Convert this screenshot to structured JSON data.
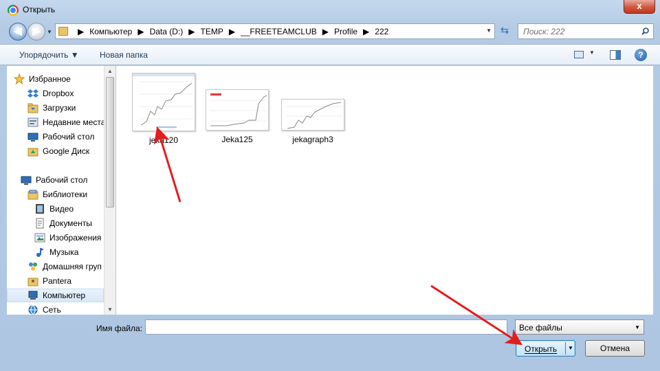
{
  "window": {
    "title": "Открыть",
    "close_glyph": "x"
  },
  "nav_buttons": {
    "back_glyph": "◀",
    "forward_glyph": "▶",
    "dropdown_glyph": "▼"
  },
  "address": {
    "crumbs": [
      "Компьютер",
      "Data (D:)",
      "TEMP",
      "__FREETEAMCLUB",
      "Profile",
      "222"
    ],
    "separator": "▶",
    "dropdown_glyph": "▼",
    "refresh_glyph": "⇆"
  },
  "search": {
    "placeholder": "Поиск: 222"
  },
  "toolbar": {
    "organize_label": "Упорядочить ▼",
    "new_folder_label": "Новая папка",
    "views_dropdown": "▼",
    "help_glyph": "?"
  },
  "navpane": {
    "items": [
      {
        "label": "Избранное",
        "icon": "star-icon",
        "indent": 0
      },
      {
        "label": "Dropbox",
        "icon": "dropbox-icon",
        "indent": 1
      },
      {
        "label": "Загрузки",
        "icon": "downloads-folder-icon",
        "indent": 1
      },
      {
        "label": "Недавние места",
        "icon": "recent-places-icon",
        "indent": 1
      },
      {
        "label": "Рабочий стол",
        "icon": "desktop-icon",
        "indent": 1
      },
      {
        "label": "Google Диск",
        "icon": "google-drive-folder-icon",
        "indent": 1
      },
      {
        "label": "Рабочий стол",
        "icon": "desktop-icon",
        "indent": 0
      },
      {
        "label": "Библиотеки",
        "icon": "libraries-icon",
        "indent": 1
      },
      {
        "label": "Видео",
        "icon": "video-icon",
        "indent": 2
      },
      {
        "label": "Документы",
        "icon": "documents-icon",
        "indent": 2
      },
      {
        "label": "Изображения",
        "icon": "pictures-icon",
        "indent": 2
      },
      {
        "label": "Музыка",
        "icon": "music-icon",
        "indent": 2
      },
      {
        "label": "Домашняя груп",
        "icon": "homegroup-icon",
        "indent": 1
      },
      {
        "label": "Pantera",
        "icon": "user-folder-icon",
        "indent": 1
      },
      {
        "label": "Компьютер",
        "icon": "computer-icon",
        "indent": 1,
        "selected": true
      },
      {
        "label": "Сеть",
        "icon": "network-icon",
        "indent": 1
      }
    ],
    "scroll_up": "▲",
    "scroll_down": "▼"
  },
  "files": [
    {
      "name": "jeka120"
    },
    {
      "name": "Jeka125"
    },
    {
      "name": "jekagraph3"
    }
  ],
  "bottom": {
    "filename_label": "Имя файла:",
    "filename_value": "",
    "filetype_value": "Все файлы",
    "filetype_dropdown": "▼",
    "open_label": "Открыть",
    "open_dropdown": "▼",
    "cancel_label": "Отмена"
  },
  "colors": {
    "annotation_arrow": "#e41d1d",
    "selection": "#d8e8f8",
    "accent": "#3c7fb1"
  }
}
